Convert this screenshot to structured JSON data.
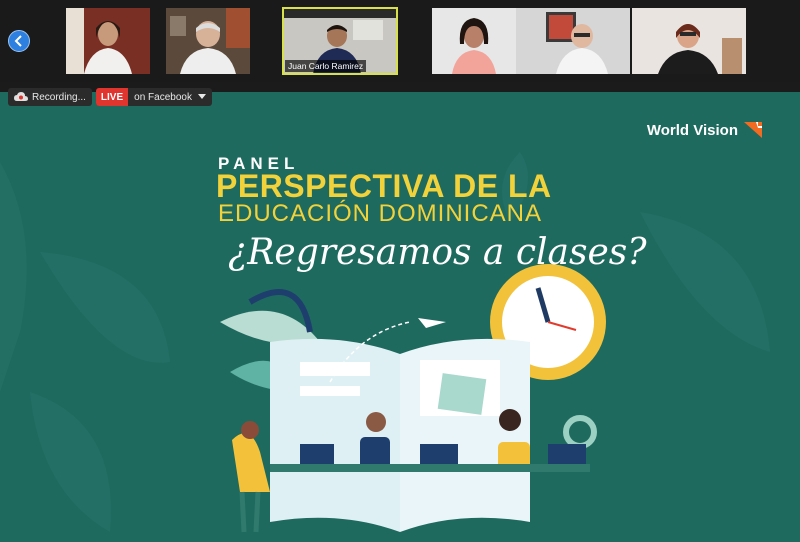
{
  "participants": [
    {
      "name": "",
      "bg": "#7a2f24"
    },
    {
      "name": "",
      "bg": "#5b4a3c"
    },
    {
      "name": "Juan Carlo Ramirez",
      "bg": "#c9c7c2",
      "active": true
    },
    {
      "name": "",
      "bg": "#e7e7e7"
    },
    {
      "name": "",
      "bg": "#d6d6d6"
    },
    {
      "name": "",
      "bg": "#e9e4df"
    }
  ],
  "status": {
    "recording_label": "Recording...",
    "live_badge": "LIVE",
    "live_target": "on Facebook"
  },
  "slide": {
    "brand": "World Vision",
    "panel_label": "PANEL",
    "title_line1": "PERSPECTIVA DE LA",
    "title_line2": "EDUCACIÓN DOMINICANA",
    "subtitle_script": "¿Regresamos a clases?",
    "colors": {
      "background": "#1f6a5f",
      "accent": "#f2d23a",
      "brand_orange": "#f26b21"
    }
  }
}
